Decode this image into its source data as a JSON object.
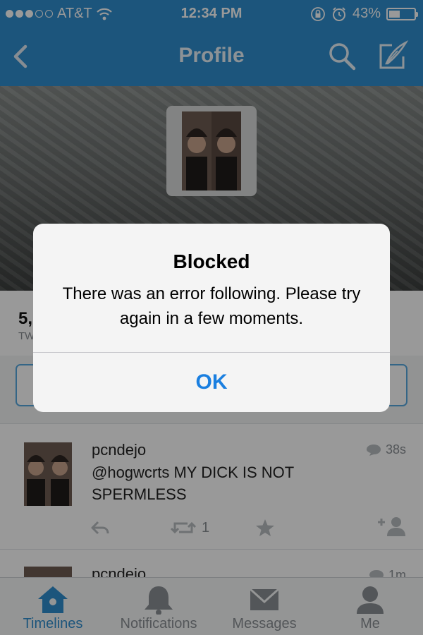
{
  "status_bar": {
    "carrier": "AT&T",
    "time": "12:34 PM",
    "battery": "43%",
    "battery_level": 0.43,
    "signal_bars": 3
  },
  "nav": {
    "title": "Profile",
    "icons": [
      "back-chevron-icon",
      "search-icon",
      "compose-icon"
    ]
  },
  "stats": {
    "tweets_count": "5,",
    "tweets_label": "TW"
  },
  "tweets": [
    {
      "username": "pcndejo",
      "time": "38s",
      "text": "@hogwcrts MY DICK IS NOT SPERMLESS",
      "retweets": "1"
    },
    {
      "username": "pcndejo",
      "time": "1m"
    }
  ],
  "tabs": [
    {
      "label": "Timelines",
      "icon": "home-icon",
      "active": true
    },
    {
      "label": "Notifications",
      "icon": "bell-icon"
    },
    {
      "label": "Messages",
      "icon": "envelope-icon"
    },
    {
      "label": "Me",
      "icon": "person-icon"
    }
  ],
  "alert": {
    "title": "Blocked",
    "message": "There was an error following. Please try again in a few moments.",
    "ok_label": "OK"
  },
  "colors": {
    "brand": "#2f8ecf",
    "link": "#1a7fe0",
    "muted": "#8a8f94"
  }
}
